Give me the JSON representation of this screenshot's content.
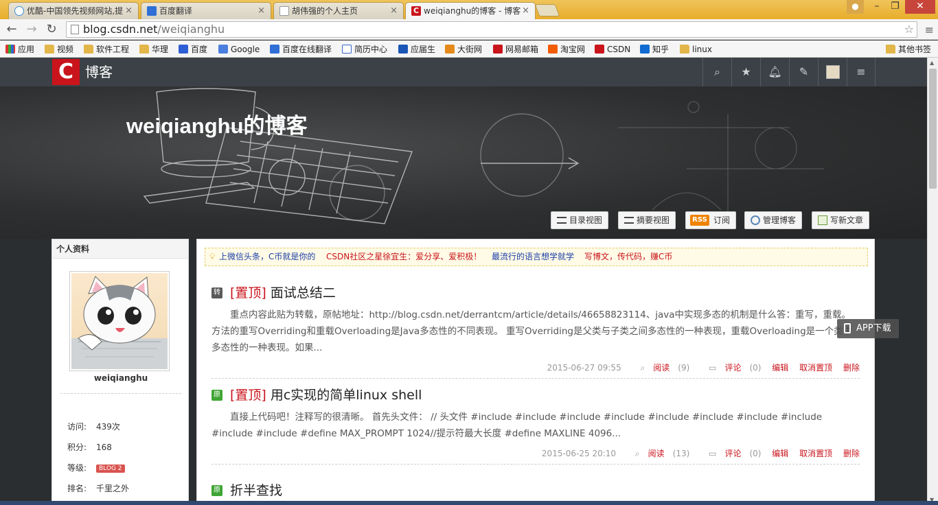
{
  "browser": {
    "tabs": [
      {
        "title": "优酷-中国领先视频网站,提",
        "color": "#3a8fd8"
      },
      {
        "title": "百度翻译",
        "color": "#2f6fd6"
      },
      {
        "title": "胡伟强的个人主页",
        "color": "#ffffff"
      },
      {
        "title": "weiqianghu的博客 - 博客",
        "color": "#c9141c"
      }
    ],
    "url_host": "blog.csdn.net",
    "url_path": "/weiqianghu",
    "bookmarks": [
      {
        "label": "应用",
        "icon": "apps-grid-icon"
      },
      {
        "label": "视频",
        "icon": "folder-icon"
      },
      {
        "label": "软件工程",
        "icon": "folder-icon"
      },
      {
        "label": "华理",
        "icon": "folder-icon"
      },
      {
        "label": "百度",
        "icon": "baidu-paw-icon"
      },
      {
        "label": "Google",
        "icon": "google-icon"
      },
      {
        "label": "百度在线翻译",
        "icon": "baidu-translate-icon"
      },
      {
        "label": "简历中心",
        "icon": "hand-icon"
      },
      {
        "label": "应届生",
        "icon": "yingjiesheng-icon"
      },
      {
        "label": "大街网",
        "icon": "dajie-icon"
      },
      {
        "label": "网易邮箱",
        "icon": "netease-icon"
      },
      {
        "label": "淘宝网",
        "icon": "taobao-icon"
      },
      {
        "label": "CSDN",
        "icon": "csdn-icon"
      },
      {
        "label": "知乎",
        "icon": "zhihu-icon"
      },
      {
        "label": "linux",
        "icon": "folder-icon"
      }
    ],
    "other_bookmarks": "其他书签"
  },
  "header": {
    "logo_letter": "C",
    "section": "博客"
  },
  "banner": {
    "title": "weiqianghu的博客",
    "buttons": [
      {
        "label": "目录视图",
        "icon": "list-icon"
      },
      {
        "label": "摘要视图",
        "icon": "summary-icon"
      },
      {
        "label": "订阅",
        "icon": "rss-icon",
        "badge": "RSS"
      },
      {
        "label": "管理博客",
        "icon": "gear-icon"
      },
      {
        "label": "写新文章",
        "icon": "pencil-icon"
      }
    ]
  },
  "sidebar": {
    "heading": "个人资料",
    "username": "weiqianghu",
    "stats": [
      {
        "label": "访问:",
        "value": "439次"
      },
      {
        "label": "积分:",
        "value": "168"
      },
      {
        "label": "等级:",
        "value": "BLOG 2"
      },
      {
        "label": "排名:",
        "value": "千里之外"
      }
    ]
  },
  "notice": {
    "links": [
      {
        "text": "上微信头条，C币就是你的",
        "color": "#1a3ea8"
      },
      {
        "text": "CSDN社区之星徐宜生：爱分享、爱积极！",
        "color": "#c9141c"
      },
      {
        "text": "最流行的语言想学就学",
        "color": "#1a3ea8"
      },
      {
        "text": "写博文，传代码，赚C币",
        "color": "#c9141c"
      }
    ]
  },
  "articles": [
    {
      "type": "转",
      "type_color": "#5a5a5a",
      "top_label": "[置顶]",
      "title": "面试总结二",
      "summary": "重点内容此贴为转载，原帖地址：http://blog.csdn.net/derrantcm/article/details/46658823114、java中实现多态的机制是什么答：重写，重载。方法的重写Overriding和重载Overloading是Java多态性的不同表现。 重写Overriding是父类与子类之间多态性的一种表现，重载Overloading是一个类中多态性的一种表现。如果...",
      "date": "2015-06-27 09:55",
      "read": "阅读",
      "read_count": "(9)",
      "comment": "评论",
      "comment_count": "(0)",
      "edit": "编辑",
      "untop": "取消置顶",
      "delete": "删除"
    },
    {
      "type": "原",
      "type_color": "#3fa535",
      "top_label": "[置顶]",
      "title": "用c实现的简单linux shell",
      "summary": "直接上代码吧！注释写的很清晰。 首先头文件： // 头文件 #include #include #include #include #include #include #include #include #include #include #define MAX_PROMPT 1024//提示符最大长度 #define MAXLINE 4096...",
      "date": "2015-06-25 20:10",
      "read": "阅读",
      "read_count": "(13)",
      "comment": "评论",
      "comment_count": "(0)",
      "edit": "编辑",
      "untop": "取消置顶",
      "delete": "删除"
    },
    {
      "type": "原",
      "type_color": "#3fa535",
      "top_label": "",
      "title": "折半查找"
    }
  ],
  "app_download": "APP下载",
  "colors": {
    "csdn_red": "#c9141c",
    "nav_bg": "#3b4146",
    "tab_bar": "#e8ad2b"
  }
}
